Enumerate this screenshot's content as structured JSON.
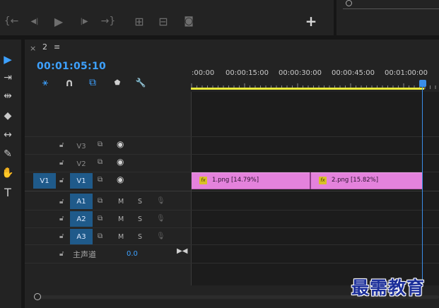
{
  "transport": {
    "buttons": [
      {
        "name": "go-to-in-icon",
        "glyph": "{←"
      },
      {
        "name": "step-back-icon",
        "glyph": "◀|"
      },
      {
        "name": "play-icon",
        "glyph": "▶"
      },
      {
        "name": "step-forward-icon",
        "glyph": "|▶"
      },
      {
        "name": "go-to-out-icon",
        "glyph": "→}"
      },
      {
        "name": "insert-icon",
        "glyph": "⊞"
      },
      {
        "name": "overwrite-icon",
        "glyph": "⊟"
      },
      {
        "name": "export-frame-icon",
        "glyph": "◙"
      }
    ],
    "add_label": "+"
  },
  "tools": [
    {
      "name": "selection-tool-icon",
      "glyph": "▶"
    },
    {
      "name": "track-select-tool-icon",
      "glyph": "⇥"
    },
    {
      "name": "ripple-edit-tool-icon",
      "glyph": "⇹"
    },
    {
      "name": "razor-tool-icon",
      "glyph": "◆"
    },
    {
      "name": "slip-tool-icon",
      "glyph": "↔"
    },
    {
      "name": "pen-tool-icon",
      "glyph": "✎"
    },
    {
      "name": "hand-tool-icon",
      "glyph": "✋"
    },
    {
      "name": "type-tool-icon",
      "glyph": "T"
    }
  ],
  "sequence": {
    "close_label": "×",
    "title": "2",
    "menu_label": "≡",
    "timecode": "00:01:05:10"
  },
  "header_buttons": [
    {
      "name": "nest-toggle-icon",
      "glyph": "⚹",
      "color": "#3da1ff"
    },
    {
      "name": "snap-icon",
      "glyph": "∩",
      "color": "#cfcfcf"
    },
    {
      "name": "linked-selection-icon",
      "glyph": "⧉",
      "color": "#3da1ff"
    },
    {
      "name": "add-marker-icon",
      "glyph": "⬟",
      "color": "#cfcfcf"
    },
    {
      "name": "timeline-settings-icon",
      "glyph": "🔧",
      "color": "#cfcfcf"
    }
  ],
  "ruler": {
    "labels": [
      ":00:00",
      "00:00:15:00",
      "00:00:30:00",
      "00:00:45:00",
      "00:01:00:00"
    ]
  },
  "tracks": {
    "video": [
      {
        "target": "V3",
        "source": ""
      },
      {
        "target": "V2",
        "source": ""
      },
      {
        "target": "V1",
        "source": "V1"
      }
    ],
    "audio": [
      {
        "target": "A1",
        "mute": "M",
        "solo": "S"
      },
      {
        "target": "A2",
        "mute": "M",
        "solo": "S"
      },
      {
        "target": "A3",
        "mute": "M",
        "solo": "S"
      }
    ],
    "master": {
      "label": "主声道",
      "value": "0.0"
    }
  },
  "clips": [
    {
      "name": "1.png [14.79%]",
      "fx": "fx"
    },
    {
      "name": "2.png [15.82%]",
      "fx": "fx"
    }
  ],
  "watermark": "最需教育"
}
